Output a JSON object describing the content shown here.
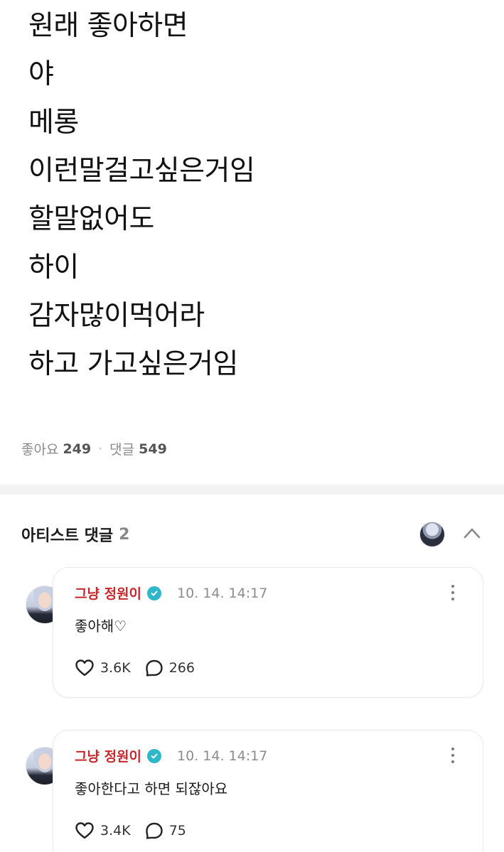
{
  "post": {
    "lines": [
      "원래 좋아하면",
      "야",
      "메롱",
      "이런말걸고싶은거임",
      "할말없어도",
      "하이",
      "감자많이먹어라",
      "하고 가고싶은거임"
    ],
    "likes_label": "좋아요",
    "likes_count": "249",
    "separator": "·",
    "comments_label": "댓글",
    "comments_count": "549"
  },
  "artist_comments": {
    "title": "아티스트 댓글",
    "count": "2",
    "items": [
      {
        "author": "그냥 정원이",
        "time": "10. 14. 14:17",
        "text": "좋아해♡",
        "likes": "3.6K",
        "replies": "266"
      },
      {
        "author": "그냥 정원이",
        "time": "10. 14. 14:17",
        "text": "좋아한다고 하면 되잖아요",
        "likes": "3.4K",
        "replies": "75"
      }
    ]
  },
  "icons": {
    "verified": "verified-badge-icon",
    "more": "more-vertical-icon",
    "like": "heart-icon",
    "reply": "comment-bubble-icon",
    "collapse": "chevron-up-icon"
  },
  "colors": {
    "author_name": "#c8262b",
    "verified_badge": "#2fb6c9",
    "muted_text": "#8c8c8c",
    "divider": "#f3f3f3"
  }
}
